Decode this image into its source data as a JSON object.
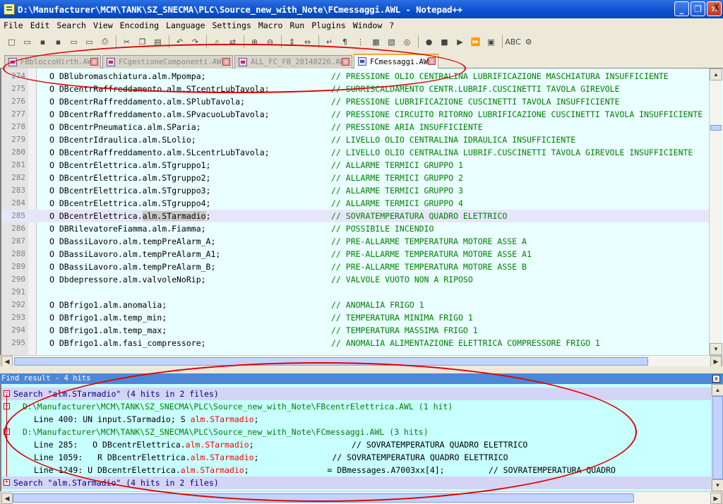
{
  "window": {
    "title": "D:\\Manufacturer\\MCM\\TANK\\SZ_SNECMA\\PLC\\Source_new_with_Note\\FCmessaggi.AWL - Notepad++",
    "minimize": "_",
    "maximize": "❐",
    "close": "✕"
  },
  "menu": [
    "File",
    "Edit",
    "Search",
    "View",
    "Encoding",
    "Language",
    "Settings",
    "Macro",
    "Run",
    "Plugins",
    "Window",
    "?"
  ],
  "menu_close": "X",
  "toolbar": [
    {
      "icon": "new-file-icon",
      "glyph": "□"
    },
    {
      "icon": "open-file-icon",
      "glyph": "▭"
    },
    {
      "icon": "save-icon",
      "glyph": "▪"
    },
    {
      "icon": "save-all-icon",
      "glyph": "▪"
    },
    {
      "icon": "close-file-icon",
      "glyph": "▭"
    },
    {
      "icon": "close-all-icon",
      "glyph": "▭"
    },
    {
      "icon": "print-icon",
      "glyph": "⎙"
    },
    {
      "sep": true
    },
    {
      "icon": "cut-icon",
      "glyph": "✂"
    },
    {
      "icon": "copy-icon",
      "glyph": "❐"
    },
    {
      "icon": "paste-icon",
      "glyph": "▤"
    },
    {
      "sep": true
    },
    {
      "icon": "undo-icon",
      "glyph": "↶"
    },
    {
      "icon": "redo-icon",
      "glyph": "↷"
    },
    {
      "sep": true
    },
    {
      "icon": "find-icon",
      "glyph": "⌕"
    },
    {
      "icon": "replace-icon",
      "glyph": "⇄"
    },
    {
      "sep": true
    },
    {
      "icon": "zoom-in-icon",
      "glyph": "⊕"
    },
    {
      "icon": "zoom-out-icon",
      "glyph": "⊖"
    },
    {
      "sep": true
    },
    {
      "icon": "sync-vertical-icon",
      "glyph": "⇕"
    },
    {
      "icon": "sync-horizontal-icon",
      "glyph": "⇔"
    },
    {
      "sep": true
    },
    {
      "icon": "word-wrap-icon",
      "glyph": "↵"
    },
    {
      "icon": "show-all-chars-icon",
      "glyph": "¶"
    },
    {
      "icon": "indent-guide-icon",
      "glyph": "⋮"
    },
    {
      "icon": "user-language-icon",
      "glyph": "▦"
    },
    {
      "icon": "doc-map-icon",
      "glyph": "▧"
    },
    {
      "icon": "function-list-icon",
      "glyph": "◎"
    },
    {
      "sep": true
    },
    {
      "icon": "record-macro-icon",
      "glyph": "●"
    },
    {
      "icon": "stop-macro-icon",
      "glyph": "■"
    },
    {
      "icon": "play-macro-icon",
      "glyph": "▶"
    },
    {
      "icon": "run-macro-multiple-icon",
      "glyph": "⏩"
    },
    {
      "icon": "save-macro-icon",
      "glyph": "▣"
    },
    {
      "sep": true
    },
    {
      "icon": "spell-check-icon",
      "glyph": "ABC"
    },
    {
      "icon": "spell-auto-icon",
      "glyph": "⚙"
    }
  ],
  "tabs": [
    {
      "label": "FBbloccoHirth.AWL",
      "active": false
    },
    {
      "label": "FCgestioneComponenti.AWL",
      "active": false
    },
    {
      "label": "ALL_FC_FB_20140226.AWL",
      "active": false
    },
    {
      "label": "FCmessaggi.AWL",
      "active": true
    }
  ],
  "editor_lines": [
    {
      "num": "274",
      "code": "O DBlubromaschiatura.alm.Mpompa;",
      "comment": "// PRESSIONE OLIO CENTRALINA LUBRIFICAZIONE MASCHIATURA INSUFFICIENTE"
    },
    {
      "num": "275",
      "code": "O DBcentrRaffreddamento.alm.STcentrLubTavola;",
      "comment": "// SURRISCALDAMENTO CENTR.LUBRIF.CUSCINETTI TAVOLA GIREVOLE"
    },
    {
      "num": "276",
      "code": "O DBcentrRaffreddamento.alm.SPlubTavola;",
      "comment": "// PRESSIONE LUBRIFICAZIONE CUSCINETTI TAVOLA INSUFFICIENTE"
    },
    {
      "num": "277",
      "code": "O DBcentrRaffreddamento.alm.SPvacuoLubTavola;",
      "comment": "// PRESSIONE CIRCUITO RITORNO LUBRIFICAZIONE CUSCINETTI TAVOLA INSUFFICIENTE"
    },
    {
      "num": "278",
      "code": "O DBcentrPneumatica.alm.SParia;",
      "comment": "// PRESSIONE ARIA INSUFFICIENTE"
    },
    {
      "num": "279",
      "code": "O DBcentrIdraulica.alm.SLolio;",
      "comment": "// LIVELLO OLIO CENTRALINA IDRAULICA INSUFFICIENTE"
    },
    {
      "num": "280",
      "code": "O DBcentrRaffreddamento.alm.SLcentrLubTavola;",
      "comment": "// LIVELLO OLIO CENTRALINA LUBRIF.CUSCINETTI TAVOLA GIREVOLE INSUFFICIENTE"
    },
    {
      "num": "281",
      "code": "O DBcentrElettrica.alm.STgruppo1;",
      "comment": "// ALLARME TERMICI GRUPPO 1"
    },
    {
      "num": "282",
      "code": "O DBcentrElettrica.alm.STgruppo2;",
      "comment": "// ALLARME TERMICI GRUPPO 2"
    },
    {
      "num": "283",
      "code": "O DBcentrElettrica.alm.STgruppo3;",
      "comment": "// ALLARME TERMICI GRUPPO 3"
    },
    {
      "num": "284",
      "code": "O DBcentrElettrica.alm.STgruppo4;",
      "comment": "// ALLARME TERMICI GRUPPO 4"
    },
    {
      "num": "285",
      "code_pre": "O DBcentrElettrica.",
      "code_hl": "alm.STarmadio",
      "code_post": ";",
      "comment": "// SOVRATEMPERATURA QUADRO ELETTRICO",
      "current": true
    },
    {
      "num": "286",
      "code": "O DBRilevatoreFiamma.alm.Fiamma;",
      "comment": "// POSSIBILE INCENDIO"
    },
    {
      "num": "287",
      "code": "O DBassiLavoro.alm.tempPreAlarm_A;",
      "comment": "// PRE-ALLARME TEMPERATURA MOTORE ASSE A"
    },
    {
      "num": "288",
      "code": "O DBassiLavoro.alm.tempPreAlarm_A1;",
      "comment": "// PRE-ALLARME TEMPERATURA MOTORE ASSE A1"
    },
    {
      "num": "289",
      "code": "O DBassiLavoro.alm.tempPreAlarm_B;",
      "comment": "// PRE-ALLARME TEMPERATURA MOTORE ASSE B"
    },
    {
      "num": "290",
      "code": "O Dbdepressore.alm.valvoleNoRip;",
      "comment": "// VALVOLE VUOTO NON A RIPOSO"
    },
    {
      "num": "291",
      "code": "",
      "comment": ""
    },
    {
      "num": "292",
      "code": "O DBfrigo1.alm.anomalia;",
      "comment": "// ANOMALIA FRIGO 1"
    },
    {
      "num": "293",
      "code": "O DBfrigo1.alm.temp_min;",
      "comment": "// TEMPERATURA MINIMA FRIGO 1"
    },
    {
      "num": "294",
      "code": "O DBfrigo1.alm.temp_max;",
      "comment": "// TEMPERATURA MASSIMA FRIGO 1"
    },
    {
      "num": "295",
      "code": "O DBfrigo1.alm.fasi_compressore;",
      "comment": "// ANOMALIA ALIMENTAZIONE ELETTRICA COMPRESSORE FRIGO 1"
    }
  ],
  "find_result": {
    "header": "Find result - 4 hits",
    "close": "x",
    "search_line": "Search \"alm.STarmadio\" (4 hits in 2 files)",
    "files": [
      {
        "path": "D:\\Manufacturer\\MCM\\TANK\\SZ_SNECMA\\PLC\\Source_new_with_Note\\FBcentrElettrica.AWL (1 hit)",
        "hits": [
          {
            "pre": "Line 400: UN input.STarmadio; S ",
            "match": "alm.STarmadio",
            "post": ";"
          }
        ]
      },
      {
        "path": "D:\\Manufacturer\\MCM\\TANK\\SZ_SNECMA\\PLC\\Source_new_with_Note\\FCmessaggi.AWL (3 hits)",
        "hits": [
          {
            "pre": "Line 285:   O DBcentrElettrica.",
            "match": "alm.STarmadio",
            "post": ";                    // SOVRATEMPERATURA QUADRO ELETTRICO"
          },
          {
            "pre": "Line 1059:   R DBcentrElettrica.",
            "match": "alm.STarmadio",
            "post": ";               // SOVRATEMPERATURA QUADRO ELETTRICO"
          },
          {
            "pre": "Line 1249: U DBcentrElettrica.",
            "match": "alm.STarmadio",
            "post": ";                = DBmessages.A7003xx[4];         // SOVRATEMPERATURA QUADRO"
          }
        ]
      }
    ],
    "search_line_2": "Search \"alm.STarmadio\" (4 hits in 2 files)"
  },
  "scroll": {
    "up": "▲",
    "down": "▼",
    "left": "◀",
    "right": "▶"
  }
}
